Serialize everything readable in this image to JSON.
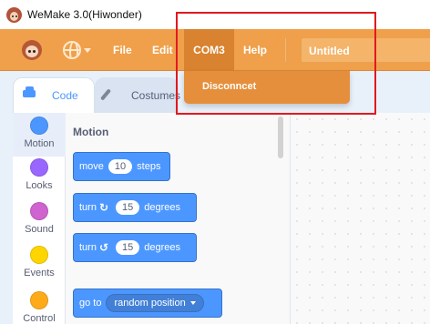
{
  "window": {
    "title": "WeMake 3.0(Hiwonder)"
  },
  "menubar": {
    "items": {
      "file": "File",
      "edit": "Edit",
      "port": "COM3",
      "help": "Help"
    },
    "project_title": "Untitled"
  },
  "port_menu": {
    "items": [
      "Disconncet"
    ]
  },
  "tabs": {
    "code": "Code",
    "costumes": "Costumes"
  },
  "categories": [
    {
      "label": "Motion",
      "color": "#4c97ff"
    },
    {
      "label": "Looks",
      "color": "#9966ff"
    },
    {
      "label": "Sound",
      "color": "#cf63cf"
    },
    {
      "label": "Events",
      "color": "#ffd500"
    },
    {
      "label": "Control",
      "color": "#ffab19"
    }
  ],
  "palette": {
    "section_title": "Motion",
    "blocks": {
      "move": {
        "prefix": "move",
        "value": "10",
        "suffix": "steps"
      },
      "turn_right": {
        "prefix": "turn",
        "icon": "rotate-right-icon",
        "value": "15",
        "suffix": "degrees"
      },
      "turn_left": {
        "prefix": "turn",
        "icon": "rotate-left-icon",
        "value": "15",
        "suffix": "degrees"
      },
      "goto": {
        "prefix": "go to",
        "option": "random position"
      }
    }
  },
  "colors": {
    "menubar": "#f0a04a",
    "highlight": "#e1191f",
    "motion": "#4c97ff"
  }
}
